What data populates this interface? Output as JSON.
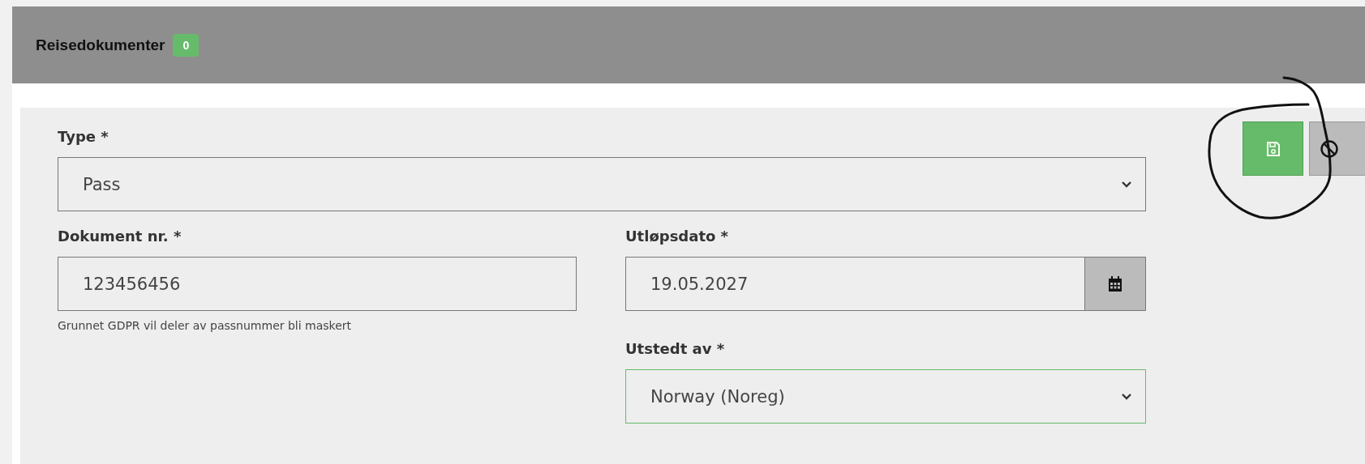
{
  "section": {
    "title": "Reisedokumenter",
    "badge": "0"
  },
  "type_field": {
    "label": "Type *",
    "value": "Pass",
    "valid": false
  },
  "document_number": {
    "label": "Dokument nr. *",
    "value": "123456456",
    "hint": "Grunnet GDPR vil deler av passnummer bli maskert",
    "valid": false
  },
  "expiry_date": {
    "label": "Utløpsdato *",
    "value": "19.05.2027",
    "valid": false
  },
  "issued_by": {
    "label": "Utstedt av *",
    "value": "Norway (Noreg)",
    "valid": true
  },
  "actions": [
    {
      "kind": "save"
    },
    {
      "kind": "cancel"
    }
  ],
  "annotation": {
    "kind": "circle"
  }
}
